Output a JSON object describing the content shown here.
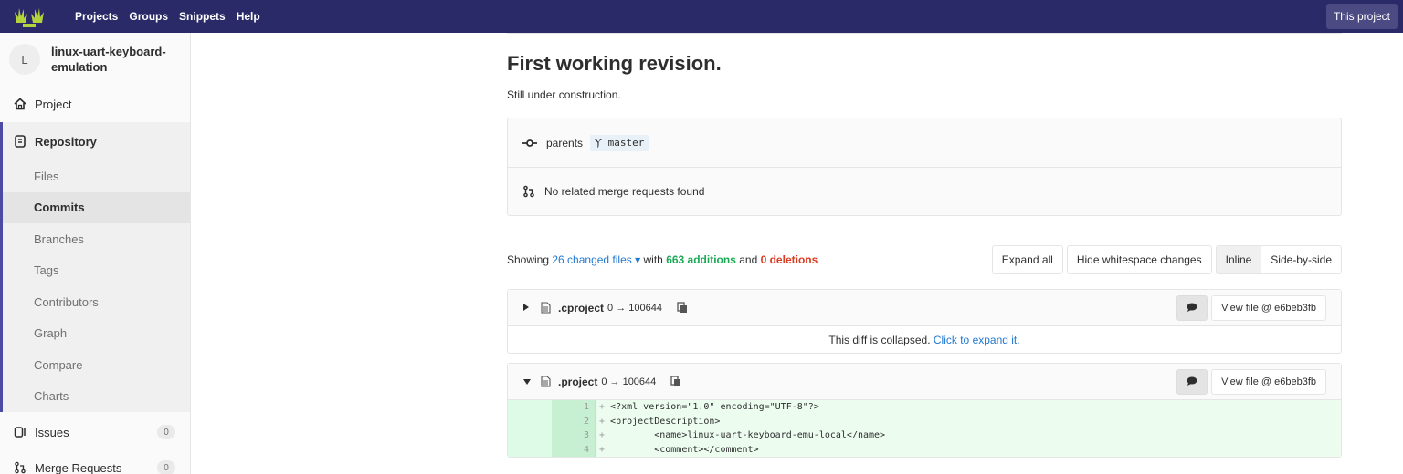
{
  "navbar": {
    "links": [
      "Projects",
      "Groups",
      "Snippets",
      "Help"
    ],
    "this_project": "This project"
  },
  "sidebar": {
    "avatar_letter": "L",
    "project_name": "linux-uart-keyboard-emulation",
    "project_label": "Project",
    "repository_label": "Repository",
    "repo_items": [
      "Files",
      "Commits",
      "Branches",
      "Tags",
      "Contributors",
      "Graph",
      "Compare",
      "Charts"
    ],
    "issues_label": "Issues",
    "issues_count": "0",
    "mr_label": "Merge Requests",
    "mr_count": "0"
  },
  "commit": {
    "title": "First working revision.",
    "description": "Still under construction.",
    "parents_label": "parents",
    "branch": "master",
    "no_mr": "No related merge requests found"
  },
  "stats": {
    "showing": "Showing",
    "changed_files": "26 changed files",
    "with": "with",
    "additions": "663 additions",
    "and": "and",
    "deletions": "0 deletions",
    "expand_all": "Expand all",
    "hide_ws": "Hide whitespace changes",
    "inline": "Inline",
    "side_by_side": "Side-by-side"
  },
  "files": [
    {
      "name": ".cproject",
      "mode": "0 → 100644",
      "view": "View file @ e6beb3fb",
      "collapsed_text": "This diff is collapsed.",
      "expand_link": "Click to expand it."
    },
    {
      "name": ".project",
      "mode": "0 → 100644",
      "view": "View file @ e6beb3fb",
      "lines": [
        {
          "n": "1",
          "code": "<?xml version=\"1.0\" encoding=\"UTF-8\"?>"
        },
        {
          "n": "2",
          "code": "<projectDescription>"
        },
        {
          "n": "3",
          "code": "        <name>linux-uart-keyboard-emu-local</name>"
        },
        {
          "n": "4",
          "code": "        <comment></comment>"
        }
      ]
    }
  ]
}
